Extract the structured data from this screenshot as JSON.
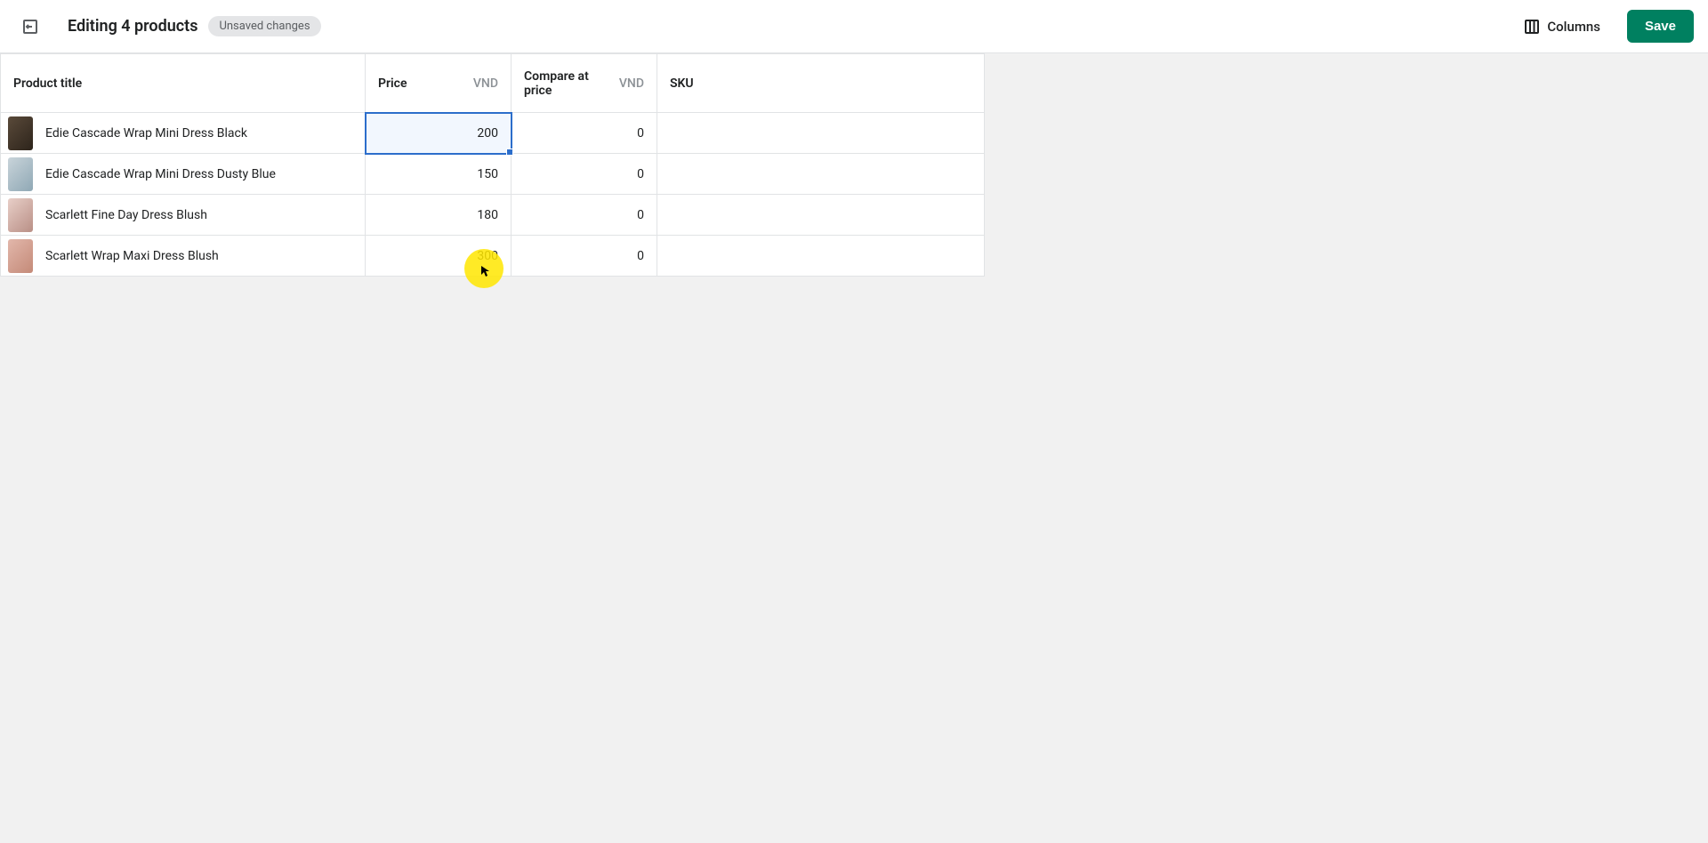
{
  "header": {
    "title": "Editing 4 products",
    "badge": "Unsaved changes",
    "columns_label": "Columns",
    "save_label": "Save"
  },
  "columns": {
    "product_title": "Product title",
    "price": "Price",
    "compare_at_price": "Compare at price",
    "sku": "SKU",
    "currency": "VND"
  },
  "rows": [
    {
      "title": "Edie Cascade Wrap Mini Dress Black",
      "price": "200",
      "compare": "0",
      "sku": ""
    },
    {
      "title": "Edie Cascade Wrap Mini Dress Dusty Blue",
      "price": "150",
      "compare": "0",
      "sku": ""
    },
    {
      "title": "Scarlett Fine Day Dress Blush",
      "price": "180",
      "compare": "0",
      "sku": ""
    },
    {
      "title": "Scarlett Wrap Maxi Dress Blush",
      "price": "300",
      "compare": "0",
      "sku": ""
    }
  ],
  "selection": {
    "row": 0,
    "col": "price"
  },
  "cursor": {
    "row": 3,
    "col": "price"
  }
}
